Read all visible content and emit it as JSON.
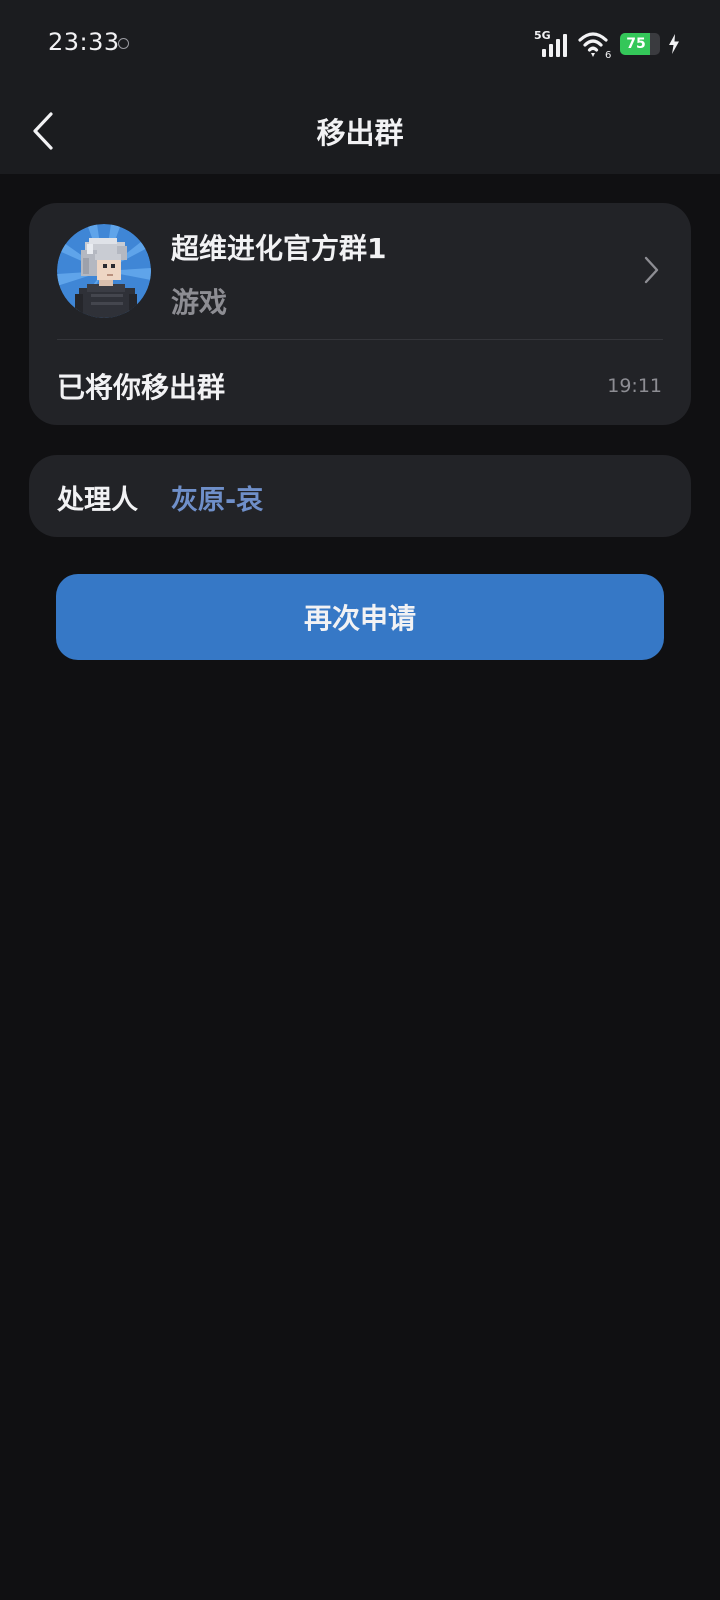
{
  "status_bar": {
    "time": "23:33",
    "network": "5G",
    "wifi_badge": "6",
    "battery_level": "75",
    "battery_fraction": 0.75,
    "charging": true
  },
  "nav": {
    "title": "移出群",
    "back_icon": "chevron-left-icon"
  },
  "group": {
    "name": "超维进化官方群1",
    "category": "游戏",
    "avatar_icon": "pixel-character-avatar",
    "open_icon": "chevron-right-icon",
    "message": "已将你移出群",
    "time": "19:11"
  },
  "handler": {
    "label": "处理人",
    "name": "灰原-哀"
  },
  "actions": {
    "reapply_label": "再次申请"
  },
  "colors": {
    "background": "#101012",
    "card": "#222327",
    "primary_button": "#3678c6",
    "handler_name": "#6f8fc9",
    "secondary_text": "#8d8d93",
    "battery": "#34c759"
  }
}
